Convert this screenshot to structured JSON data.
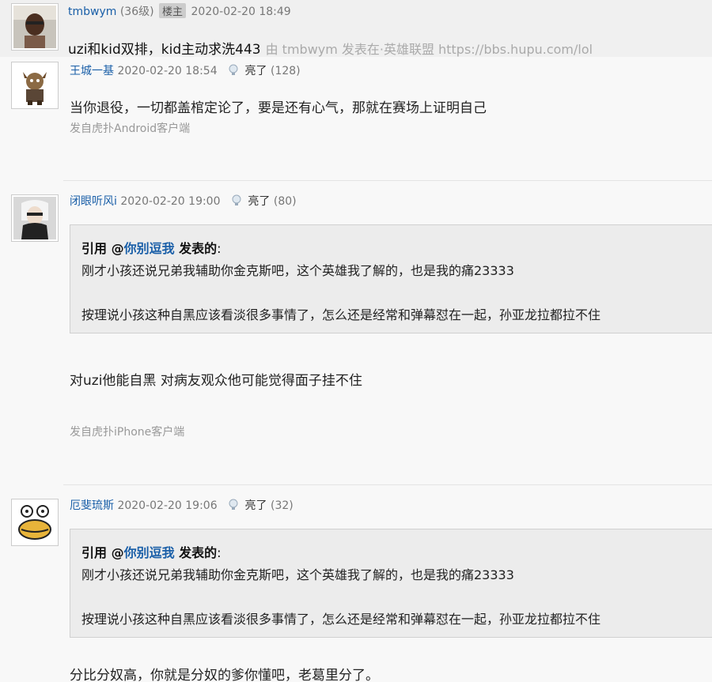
{
  "op": {
    "username": "tmbwym",
    "level": "(36级)",
    "badge": "楼主",
    "time": "2020-02-20 18:49",
    "title": "uzi和kid双排，kid主动求洗443",
    "source": "由  tmbwym 发表在·英雄联盟 https://bbs.hupu.com/lol"
  },
  "posts": [
    {
      "username": "王城一基",
      "time": "2020-02-20 18:54",
      "light_label": "亮了",
      "light_count": "(128)",
      "content": "当你退役，一切都盖棺定论了，要是还有心气，那就在赛场上证明自己",
      "client": "发自虎扑Android客户端"
    },
    {
      "username": "闭眼听风i",
      "time": "2020-02-20 19:00",
      "light_label": "亮了",
      "light_count": "(80)",
      "quote": {
        "prefix": "引用 @",
        "user": "你别逗我",
        "suffix": " 发表的",
        "colon": ":",
        "line1": "刚才小孩还说兄弟我辅助你金克斯吧，这个英雄我了解的，也是我的痛23333",
        "line2": "按理说小孩这种自黑应该看淡很多事情了，怎么还是经常和弹幕怼在一起，孙亚龙拉都拉不住"
      },
      "content": "对uzi他能自黑 对病友观众他可能觉得面子挂不住",
      "client": "发自虎扑iPhone客户端"
    },
    {
      "username": "厄斐琉斯",
      "time": "2020-02-20 19:06",
      "light_label": "亮了",
      "light_count": "(32)",
      "quote": {
        "prefix": "引用 @",
        "user": "你别逗我",
        "suffix": " 发表的",
        "colon": ":",
        "line1": "刚才小孩还说兄弟我辅助你金克斯吧，这个英雄我了解的，也是我的痛23333",
        "line2": "按理说小孩这种自黑应该看淡很多事情了，怎么还是经常和弹幕怼在一起，孙亚龙拉都拉不住"
      },
      "content": "分比分奴高，你就是分奴的爹你懂吧，老葛里分了。"
    }
  ]
}
